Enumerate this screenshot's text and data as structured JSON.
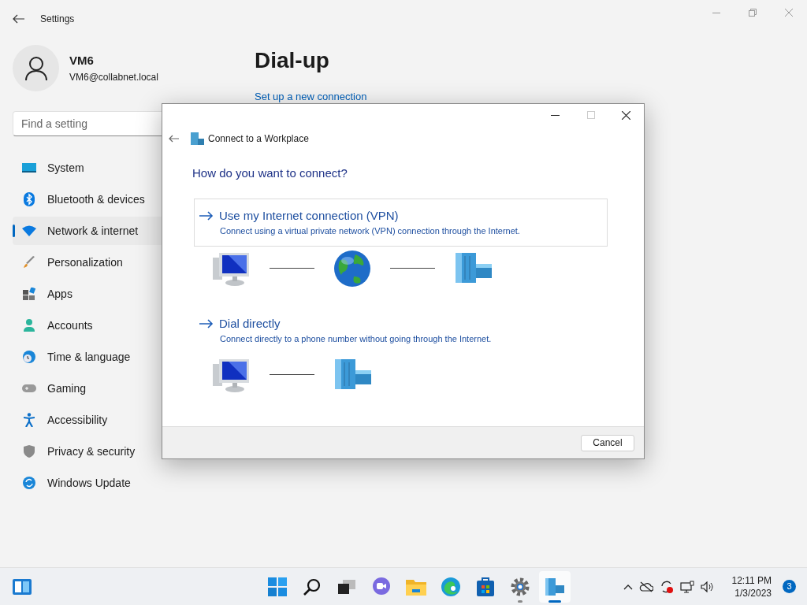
{
  "window": {
    "title": "Settings"
  },
  "user": {
    "name": "VM6",
    "email": "VM6@collabnet.local"
  },
  "search": {
    "placeholder": "Find a setting"
  },
  "sidebar": {
    "items": [
      {
        "label": "System",
        "selected": false
      },
      {
        "label": "Bluetooth & devices",
        "selected": false
      },
      {
        "label": "Network & internet",
        "selected": true
      },
      {
        "label": "Personalization",
        "selected": false
      },
      {
        "label": "Apps",
        "selected": false
      },
      {
        "label": "Accounts",
        "selected": false
      },
      {
        "label": "Time & language",
        "selected": false
      },
      {
        "label": "Gaming",
        "selected": false
      },
      {
        "label": "Accessibility",
        "selected": false
      },
      {
        "label": "Privacy & security",
        "selected": false
      },
      {
        "label": "Windows Update",
        "selected": false
      }
    ]
  },
  "page": {
    "title": "Dial-up",
    "link": "Set up a new connection"
  },
  "dialog": {
    "title": "Connect to a Workplace",
    "heading": "How do you want to connect?",
    "options": [
      {
        "title": "Use my Internet connection (VPN)",
        "description": "Connect using a virtual private network (VPN) connection through the Internet.",
        "hovered": true,
        "diagram": [
          {
            "kind": "computer"
          },
          {
            "kind": "globe"
          },
          {
            "kind": "server"
          }
        ]
      },
      {
        "title": "Dial directly",
        "description": "Connect directly to a phone number without going through the Internet.",
        "hovered": false,
        "diagram": [
          {
            "kind": "computer"
          },
          {
            "kind": "server"
          }
        ]
      }
    ],
    "buttons": [
      "Cancel"
    ]
  },
  "taskbar": {
    "apps": [
      {
        "running": false,
        "selected": false
      },
      {
        "running": false,
        "selected": false
      },
      {
        "running": false,
        "selected": false
      },
      {
        "running": false,
        "selected": false
      },
      {
        "running": false,
        "selected": false
      },
      {
        "running": false,
        "selected": false
      },
      {
        "running": false,
        "selected": false
      },
      {
        "running": true,
        "selected": false
      },
      {
        "running": true,
        "selected": true
      }
    ],
    "time": "12:11 PM",
    "date": "1/3/2023",
    "notifications": "3"
  }
}
